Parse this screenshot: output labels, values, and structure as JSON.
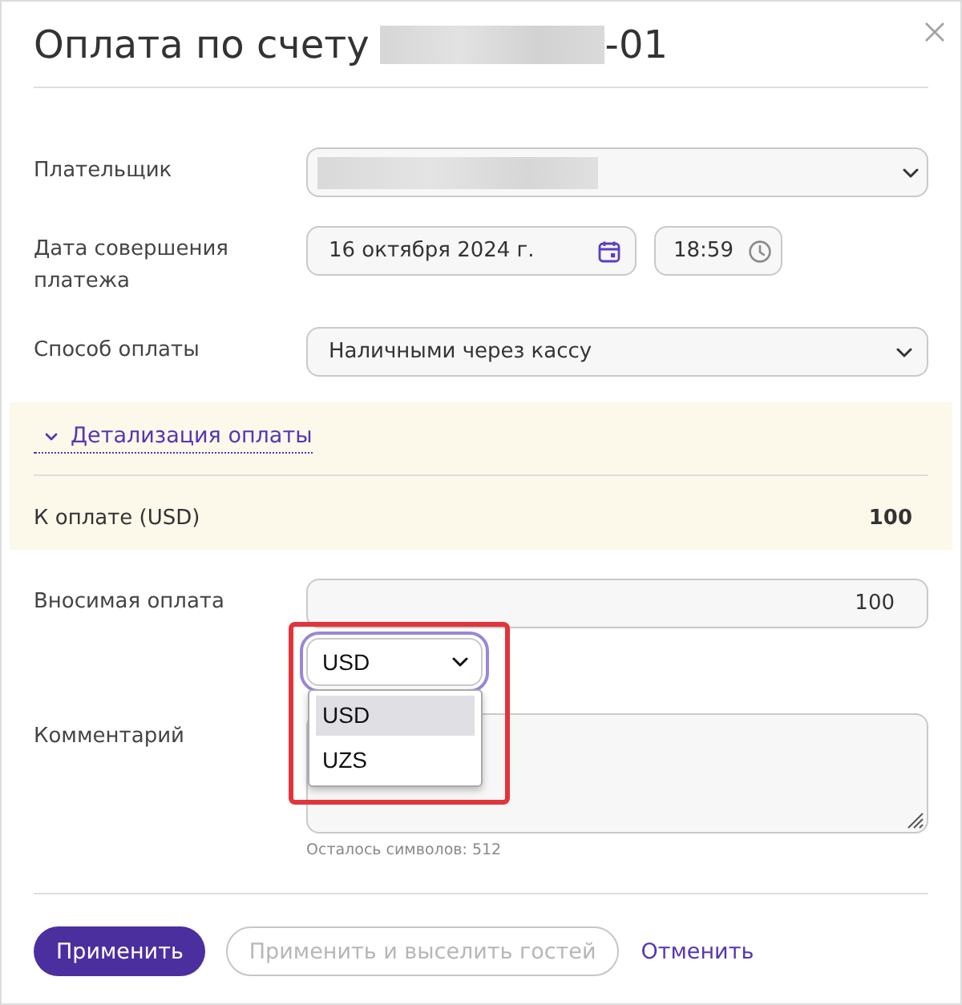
{
  "dialog": {
    "title": "Оплата по счету",
    "number_redacted": true,
    "title_suffix": "-01"
  },
  "fields": [
    {
      "kind": "select",
      "label": "Плательщик",
      "value_redacted": true
    },
    {
      "kind": "datetime",
      "label": "Дата совершения платежа",
      "date": "16 октября 2024 г.",
      "time": "18:59"
    },
    {
      "kind": "select",
      "label": "Способ оплаты",
      "value": "Наличными через кассу"
    }
  ],
  "details": {
    "toggle": "Детализация оплаты",
    "expanded": true,
    "rows": [
      {
        "label": "К оплате (USD)",
        "value": "100"
      }
    ]
  },
  "payment": {
    "label": "Вносимая оплата",
    "value": "100",
    "currency": {
      "value": "USD",
      "focused": true,
      "open": true,
      "highlighted": true,
      "options": [
        {
          "label": "USD",
          "selected": true
        },
        {
          "label": "UZS",
          "selected": false
        }
      ]
    }
  },
  "comment": {
    "label": "Комментарий",
    "counter": "Осталось символов: 512"
  },
  "buttons": [
    {
      "kind": "primary",
      "label": "Применить",
      "disabled": false
    },
    {
      "kind": "outline",
      "label": "Применить и выселить гостей",
      "disabled": true
    },
    {
      "kind": "link",
      "label": "Отменить",
      "disabled": false
    }
  ]
}
